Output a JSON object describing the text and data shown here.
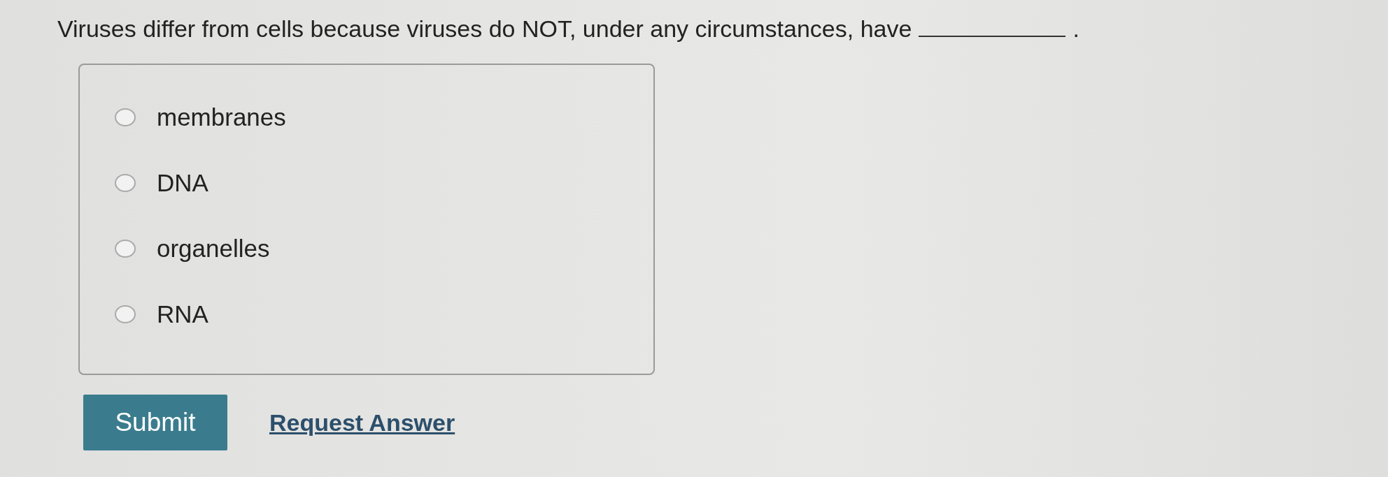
{
  "question": {
    "text": "Viruses differ from cells because viruses do NOT, under any circumstances, have",
    "end": "."
  },
  "options": [
    {
      "label": "membranes",
      "selected": false
    },
    {
      "label": "DNA",
      "selected": false
    },
    {
      "label": "organelles",
      "selected": false
    },
    {
      "label": "RNA",
      "selected": false
    }
  ],
  "submit": "Submit",
  "request_answer": "Request Answer"
}
